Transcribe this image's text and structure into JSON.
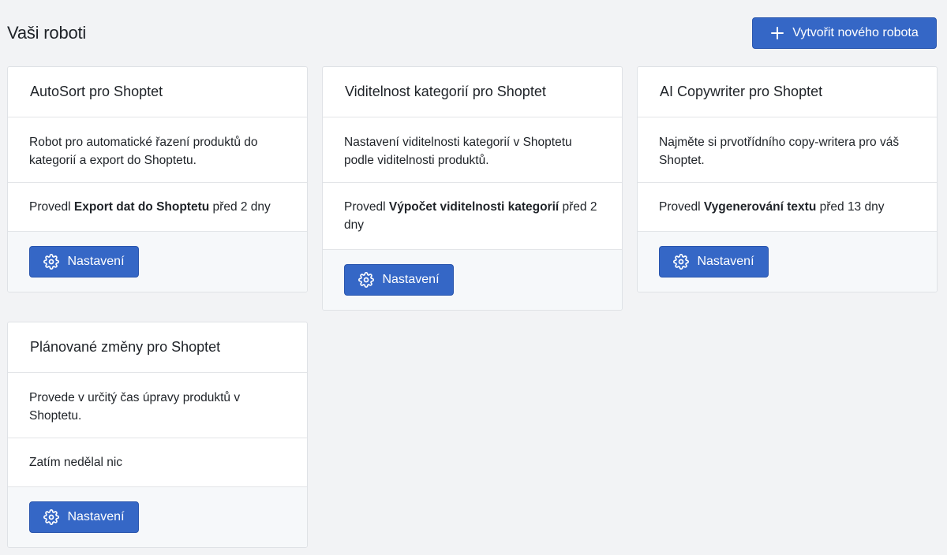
{
  "header": {
    "title": "Vaši roboti",
    "create_button": "Vytvořit nového robota"
  },
  "robots": [
    {
      "name": "AutoSort pro Shoptet",
      "description": "Robot pro automatické řazení produktů do kategorií a export do Shoptetu.",
      "activity_prefix": "Provedl",
      "activity_action": "Export dat do Shoptetu",
      "activity_suffix": "před 2 dny",
      "settings_label": "Nastavení"
    },
    {
      "name": "Viditelnost kategorií pro Shoptet",
      "description": "Nastavení viditelnosti kategorií v Shoptetu podle viditelnosti produktů.",
      "activity_prefix": "Provedl",
      "activity_action": "Výpočet viditelnosti kategorií",
      "activity_suffix": "před 2 dny",
      "settings_label": "Nastavení"
    },
    {
      "name": "AI Copywriter pro Shoptet",
      "description": "Najměte si prvotřídního copy-writera pro váš Shoptet.",
      "activity_prefix": "Provedl",
      "activity_action": "Vygenerování textu",
      "activity_suffix": "před 13 dny",
      "settings_label": "Nastavení"
    },
    {
      "name": "Plánované změny pro Shoptet",
      "description": "Provede v určitý čas úpravy produktů v Shoptetu.",
      "activity_text": "Zatím nedělal nic",
      "settings_label": "Nastavení"
    }
  ],
  "colors": {
    "primary": "#3567c6",
    "background": "#f2f3f5",
    "card_footer": "#f6f8fa"
  },
  "icons": {
    "create": "plus-icon",
    "settings": "gear-icon"
  }
}
